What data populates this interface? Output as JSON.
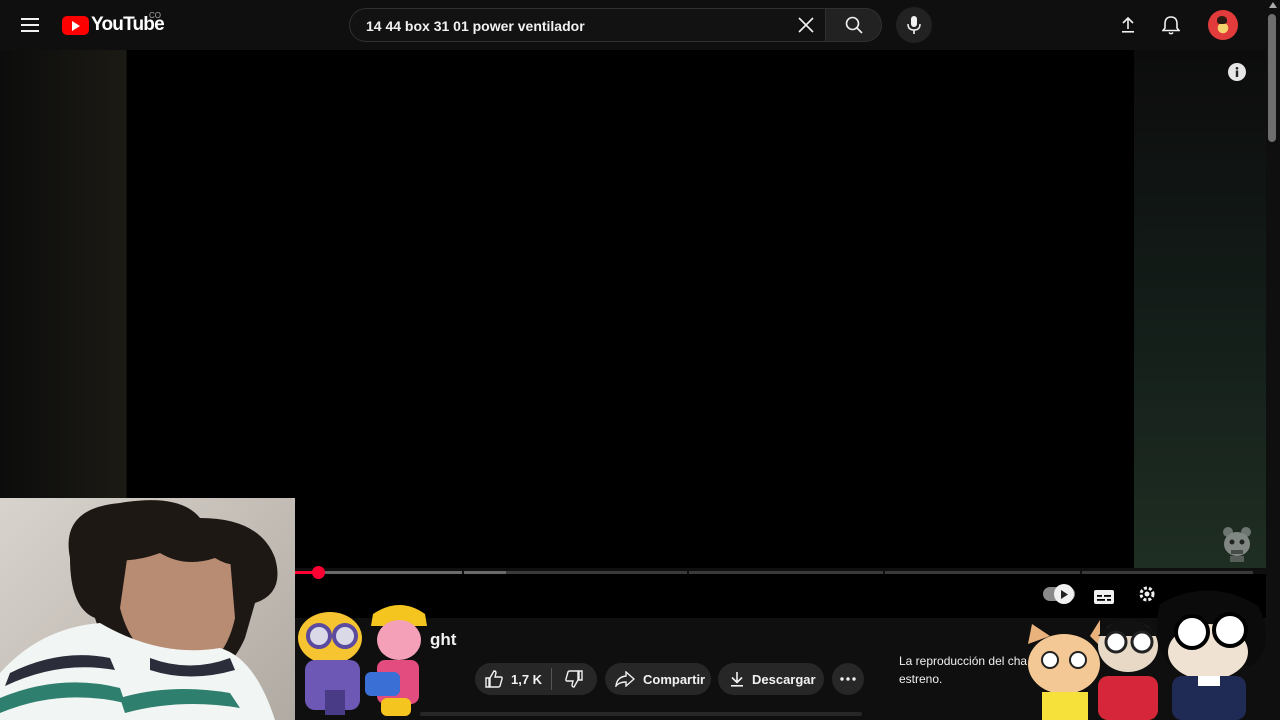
{
  "header": {
    "logo_text": "YouTube",
    "country_code": "CO",
    "search_value": "14 44 box 31 01 power ventilador",
    "icons": [
      "menu-icon",
      "youtube-logo",
      "close-icon",
      "search-icon",
      "microphone-icon",
      "upload-icon",
      "bell-icon",
      "avatar"
    ]
  },
  "player": {
    "progress_fraction": 0.024,
    "buffered_fraction": 0.22,
    "controls": [
      "autoplay-toggle",
      "subtitles-icon",
      "settings-icon"
    ],
    "info_icon": "info-icon"
  },
  "video": {
    "title_fragment": "ght"
  },
  "actions": {
    "like_count": "1,7 K",
    "share_label": "Compartir",
    "download_label": "Descargar"
  },
  "chat": {
    "notice": "La reproducción del cha estreno."
  },
  "colors": {
    "background": "#0f0f0f",
    "brand_red": "#ff0000",
    "progress_red": "#ff0033",
    "pill": "#272727"
  }
}
